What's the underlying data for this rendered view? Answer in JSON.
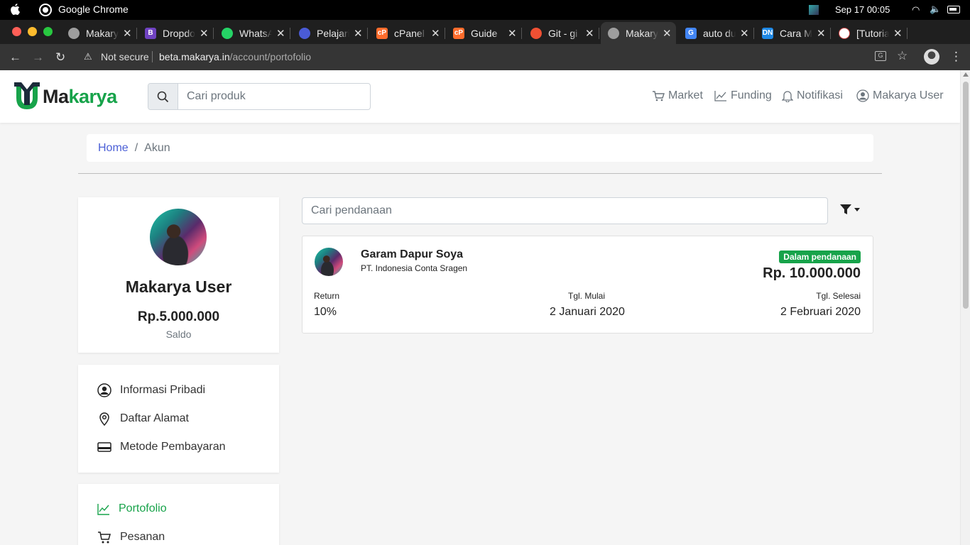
{
  "os": {
    "app_name": "Google Chrome",
    "clock": "Sep 17  00:05"
  },
  "browser": {
    "tabs": [
      {
        "label": "Makarya",
        "color": "#9e9e9e",
        "glyph": "",
        "active": false
      },
      {
        "label": "Dropdown",
        "color": "#6f42c1",
        "glyph": "B",
        "active": false
      },
      {
        "label": "WhatsApp",
        "color": "#25d366",
        "glyph": "",
        "active": false
      },
      {
        "label": "Pelajari",
        "color": "#4a5bd6",
        "glyph": "",
        "active": false
      },
      {
        "label": "cPanel",
        "color": "#ff6c2c",
        "glyph": "cP",
        "active": false
      },
      {
        "label": "Guide",
        "color": "#ff6c2c",
        "glyph": "cP",
        "active": false
      },
      {
        "label": "Git - gi",
        "color": "#f05033",
        "glyph": "",
        "active": false
      },
      {
        "label": "Makarya",
        "color": "#9e9e9e",
        "glyph": "",
        "active": true
      },
      {
        "label": "auto du",
        "color": "#4285f4",
        "glyph": "G",
        "active": false
      },
      {
        "label": "Cara M",
        "color": "#1e88e5",
        "glyph": "DN",
        "active": false
      },
      {
        "label": "[Tutorial",
        "color": "#ffffff",
        "glyph": "",
        "active": false
      }
    ],
    "security_label": "Not secure",
    "url_host": "beta.makarya.in",
    "url_path": "/account/portofolio"
  },
  "navbar": {
    "brand_a": "Ma",
    "brand_b": "karya",
    "search_placeholder": "Cari produk",
    "links": {
      "market": "Market",
      "funding": "Funding",
      "notifikasi": "Notifikasi",
      "user": "Makarya User"
    }
  },
  "breadcrumb": {
    "home": "Home",
    "separator": "/",
    "current": "Akun"
  },
  "profile": {
    "name": "Makarya User",
    "saldo_value": "Rp.5.000.000",
    "saldo_label": "Saldo"
  },
  "menu": {
    "informasi": "Informasi Pribadi",
    "alamat": "Daftar Alamat",
    "pembayaran": "Metode Pembayaran",
    "portofolio": "Portofolio",
    "pesanan": "Pesanan"
  },
  "funding_search_placeholder": "Cari pendanaan",
  "funding_item": {
    "name": "Garam Dapur Soya",
    "company": "PT. Indonesia Conta Sragen",
    "status": "Dalam pendanaan",
    "amount": "Rp. 10.000.000",
    "return_label": "Return",
    "return_value": "10%",
    "start_label": "Tgl. Mulai",
    "start_value": "2 Januari 2020",
    "end_label": "Tgl. Selesai",
    "end_value": "2 Februari 2020"
  }
}
